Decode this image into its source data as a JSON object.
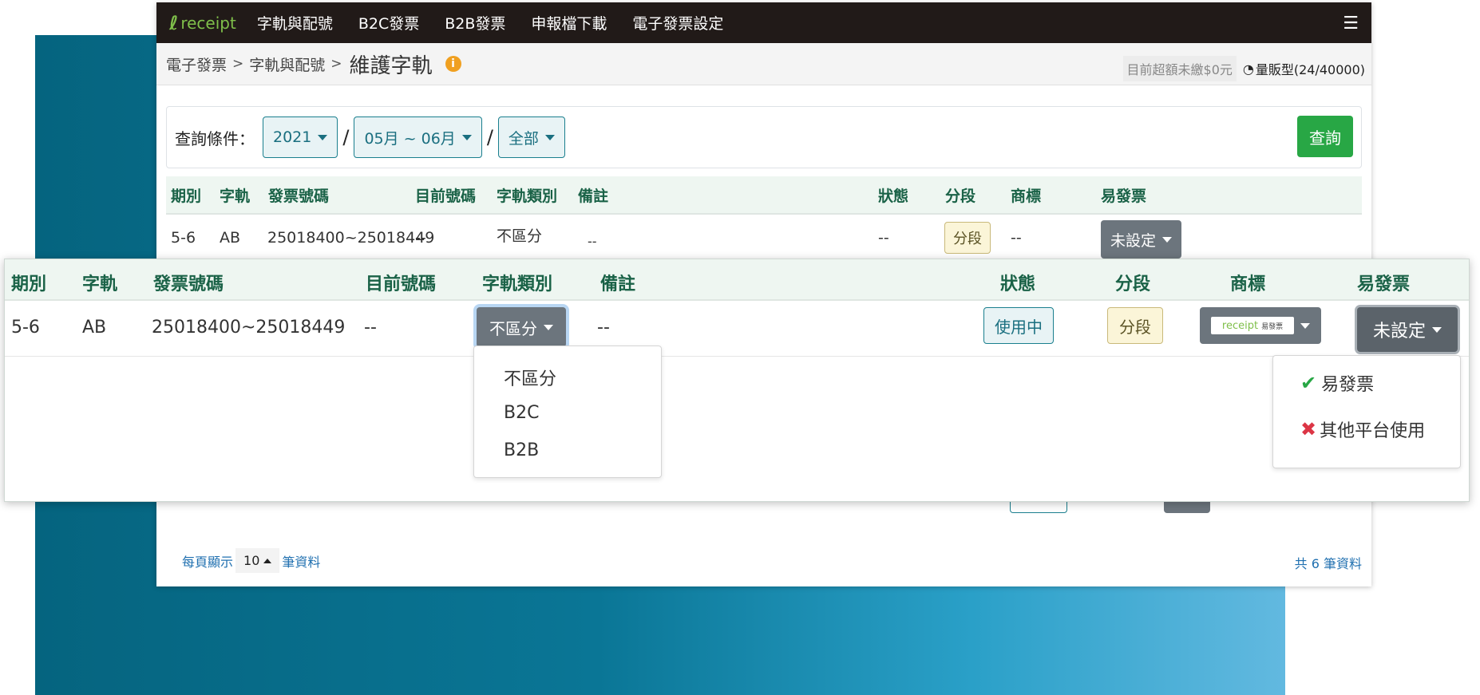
{
  "navbar": {
    "logo_text": "receipt",
    "items": [
      "字軌與配號",
      "B2C發票",
      "B2B發票",
      "申報檔下載",
      "電子發票設定"
    ]
  },
  "breadcrumb": {
    "items": [
      "電子發票",
      "字軌與配號"
    ],
    "title": "維護字軌",
    "separator": ">"
  },
  "account": {
    "overage": "目前超額未繳$0元",
    "plan": "量販型(24/40000)"
  },
  "query": {
    "label": "查詢條件：",
    "year": "2021",
    "period": "05月 ~ 06月",
    "type": "全部",
    "slash": "/",
    "submit": "查詢"
  },
  "table": {
    "headers": [
      "期別",
      "字軌",
      "發票號碼",
      "目前號碼",
      "字軌類別",
      "備註",
      "狀態",
      "分段",
      "商標",
      "易發票"
    ],
    "row": {
      "period": "5-6",
      "track": "AB",
      "range": "25018400~25018449",
      "current": "--",
      "category": "不區分",
      "note": "--",
      "status": "--",
      "segment": "分段",
      "brand": "--",
      "easy": "未設定"
    }
  },
  "zoom": {
    "status": "使用中",
    "brand_logo": "receipt",
    "brand_sub": "易發票"
  },
  "category_menu": [
    "不區分",
    "B2C",
    "B2B"
  ],
  "easy_menu": [
    "易發票",
    "其他平台使用"
  ],
  "footer": {
    "prefix": "每頁顯示",
    "page_size": "10",
    "suffix": "筆資料",
    "total": "共 6 筆資料"
  }
}
